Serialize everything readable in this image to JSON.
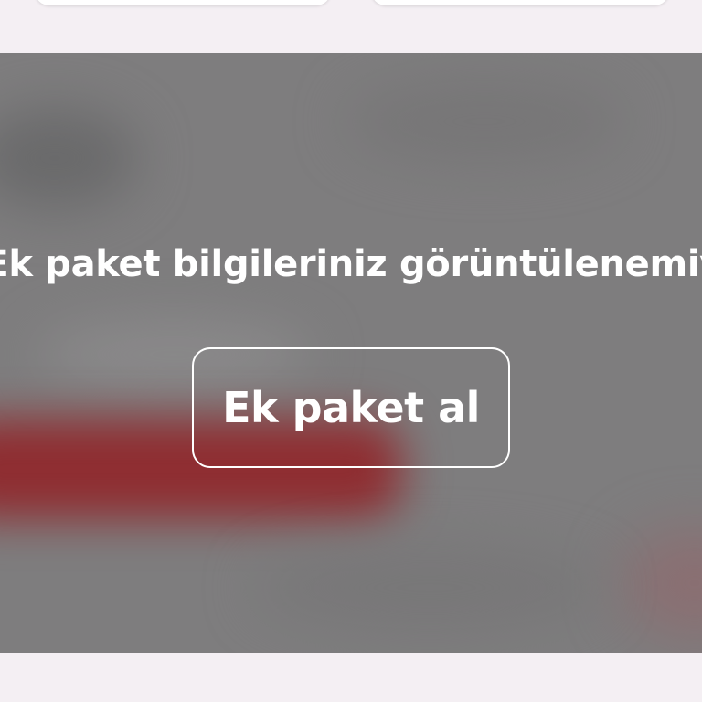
{
  "banner": {
    "message": "Ek paket bilgileriniz görüntülenemiyor",
    "cta_label": "Ek paket al"
  },
  "colors": {
    "background": "#f4eff3",
    "panel_overlay": "#7e7d7e",
    "text": "#ffffff",
    "accent_blur": "#8f2d31"
  }
}
